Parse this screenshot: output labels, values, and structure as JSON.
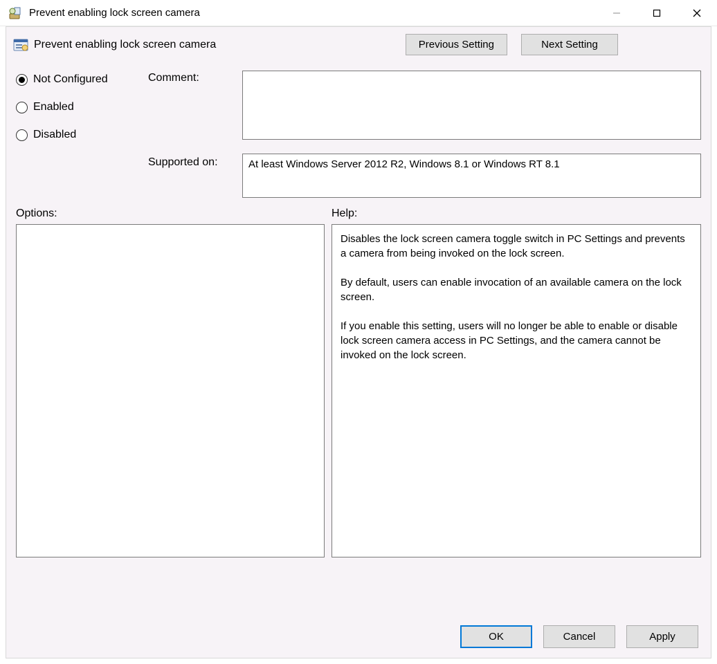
{
  "window": {
    "title": "Prevent enabling lock screen camera"
  },
  "header": {
    "policy_name": "Prevent enabling lock screen camera",
    "prev_button": "Previous Setting",
    "next_button": "Next Setting"
  },
  "state": {
    "options": [
      {
        "label": "Not Configured",
        "checked": true
      },
      {
        "label": "Enabled",
        "checked": false
      },
      {
        "label": "Disabled",
        "checked": false
      }
    ]
  },
  "labels": {
    "comment": "Comment:",
    "supported_on": "Supported on:",
    "options": "Options:",
    "help": "Help:"
  },
  "comment_value": "",
  "supported_value": "At least Windows Server 2012 R2, Windows 8.1 or Windows RT 8.1",
  "help_text": "Disables the lock screen camera toggle switch in PC Settings and prevents a camera from being invoked on the lock screen.\n\nBy default, users can enable invocation of an available camera on the lock screen.\n\nIf you enable this setting, users will no longer be able to enable or disable lock screen camera access in PC Settings, and the camera cannot be invoked on the lock screen.",
  "footer": {
    "ok": "OK",
    "cancel": "Cancel",
    "apply": "Apply"
  }
}
